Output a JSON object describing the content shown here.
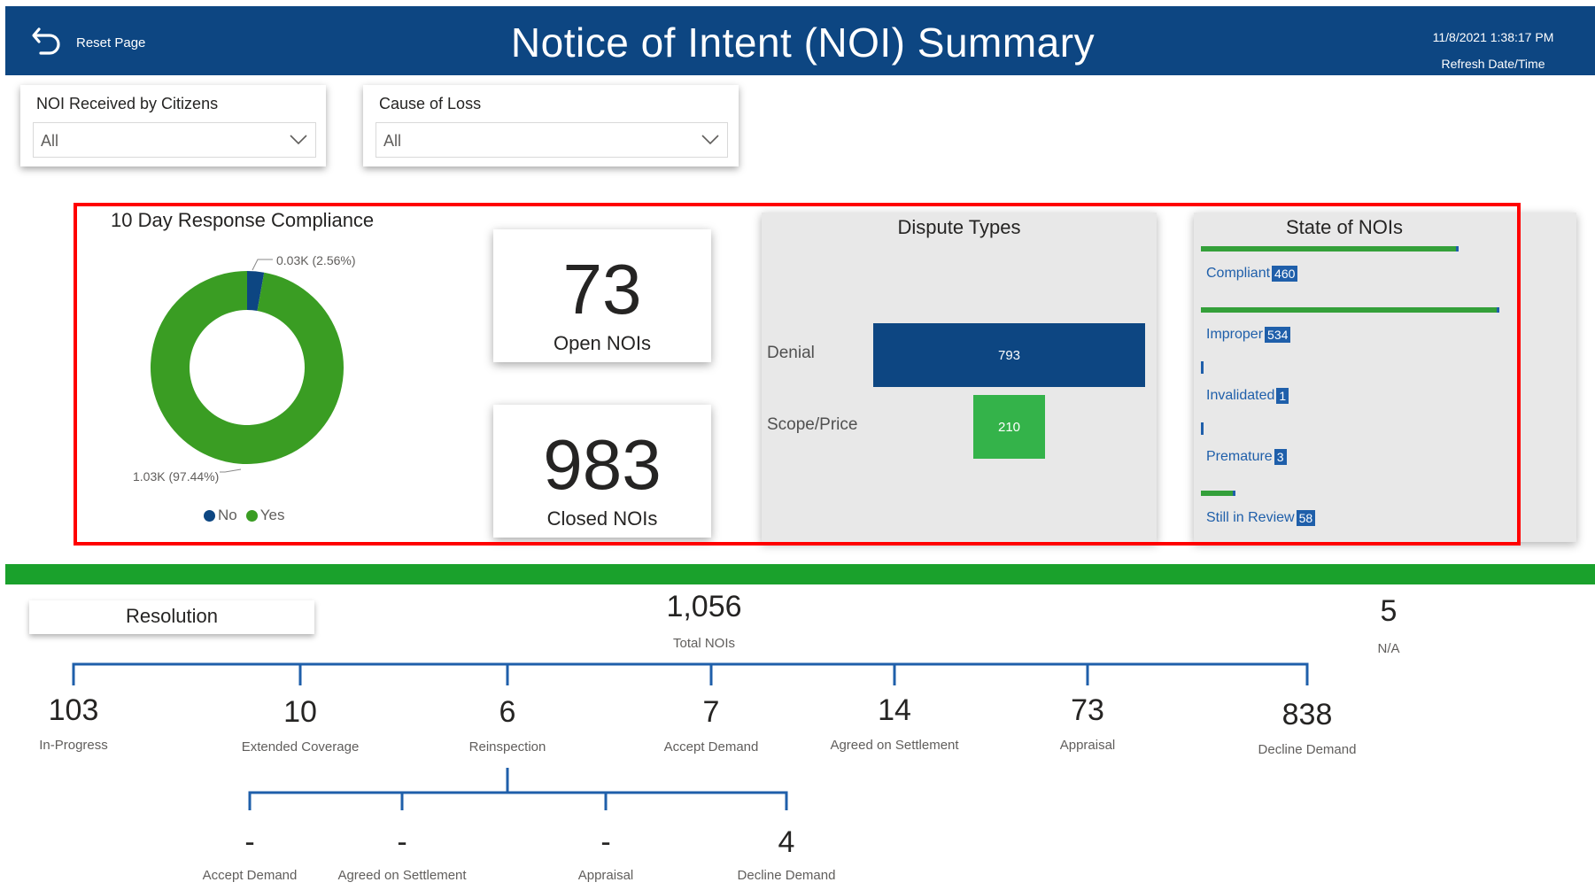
{
  "header": {
    "reset_label": "Reset Page",
    "title": "Notice of Intent (NOI) Summary",
    "refresh_datetime": "11/8/2021 1:38:17 PM",
    "refresh_label": "Refresh Date/Time"
  },
  "slicers": {
    "received": {
      "title": "NOI Received by Citizens",
      "value": "All"
    },
    "cause": {
      "title": "Cause of Loss",
      "value": "All"
    }
  },
  "compliance": {
    "title": "10 Day Response Compliance",
    "no_label": "0.03K (2.56%)",
    "yes_label": "1.03K (97.44%)",
    "legend_no": "No",
    "legend_yes": "Yes",
    "colors": {
      "no": "#0d4682",
      "yes": "#3a9d23"
    }
  },
  "cards": {
    "open": {
      "value": "73",
      "label": "Open NOIs"
    },
    "closed": {
      "value": "983",
      "label": "Closed NOIs"
    }
  },
  "dispute": {
    "title": "Dispute Types",
    "categories": [
      "Denial",
      "Scope/Price"
    ],
    "values": [
      "793",
      "210"
    ]
  },
  "state": {
    "title": "State of NOIs",
    "items": [
      {
        "label": "Compliant",
        "value": "460"
      },
      {
        "label": "Improper",
        "value": "534"
      },
      {
        "label": "Invalidated",
        "value": "1"
      },
      {
        "label": "Premature",
        "value": "3"
      },
      {
        "label": "Still in Review",
        "value": "58"
      }
    ]
  },
  "resolution": {
    "title": "Resolution",
    "total_value": "1,056",
    "total_label": "Total NOIs",
    "na_value": "5",
    "na_label": "N/A",
    "branches": [
      {
        "value": "103",
        "label": "In-Progress"
      },
      {
        "value": "10",
        "label": "Extended Coverage"
      },
      {
        "value": "6",
        "label": "Reinspection"
      },
      {
        "value": "7",
        "label": "Accept Demand"
      },
      {
        "value": "14",
        "label": "Agreed on Settlement"
      },
      {
        "value": "73",
        "label": "Appraisal"
      },
      {
        "value": "838",
        "label": "Decline Demand"
      }
    ],
    "sub_branches": [
      {
        "value": "-",
        "label": "Accept Demand"
      },
      {
        "value": "-",
        "label": "Agreed on Settlement"
      },
      {
        "value": "-",
        "label": "Appraisal"
      },
      {
        "value": "4",
        "label": "Decline Demand"
      }
    ]
  },
  "chart_data": [
    {
      "type": "pie",
      "title": "10 Day Response Compliance",
      "categories": [
        "No",
        "Yes"
      ],
      "values": [
        0.03,
        1.03
      ],
      "percent": [
        2.56,
        97.44
      ],
      "legend": "bottom"
    },
    {
      "type": "bar",
      "title": "Dispute Types",
      "categories": [
        "Denial",
        "Scope/Price"
      ],
      "values": [
        793,
        210
      ]
    },
    {
      "type": "bar",
      "title": "State of NOIs",
      "categories": [
        "Compliant",
        "Improper",
        "Invalidated",
        "Premature",
        "Still in Review"
      ],
      "values": [
        460,
        534,
        1,
        3,
        58
      ]
    }
  ]
}
